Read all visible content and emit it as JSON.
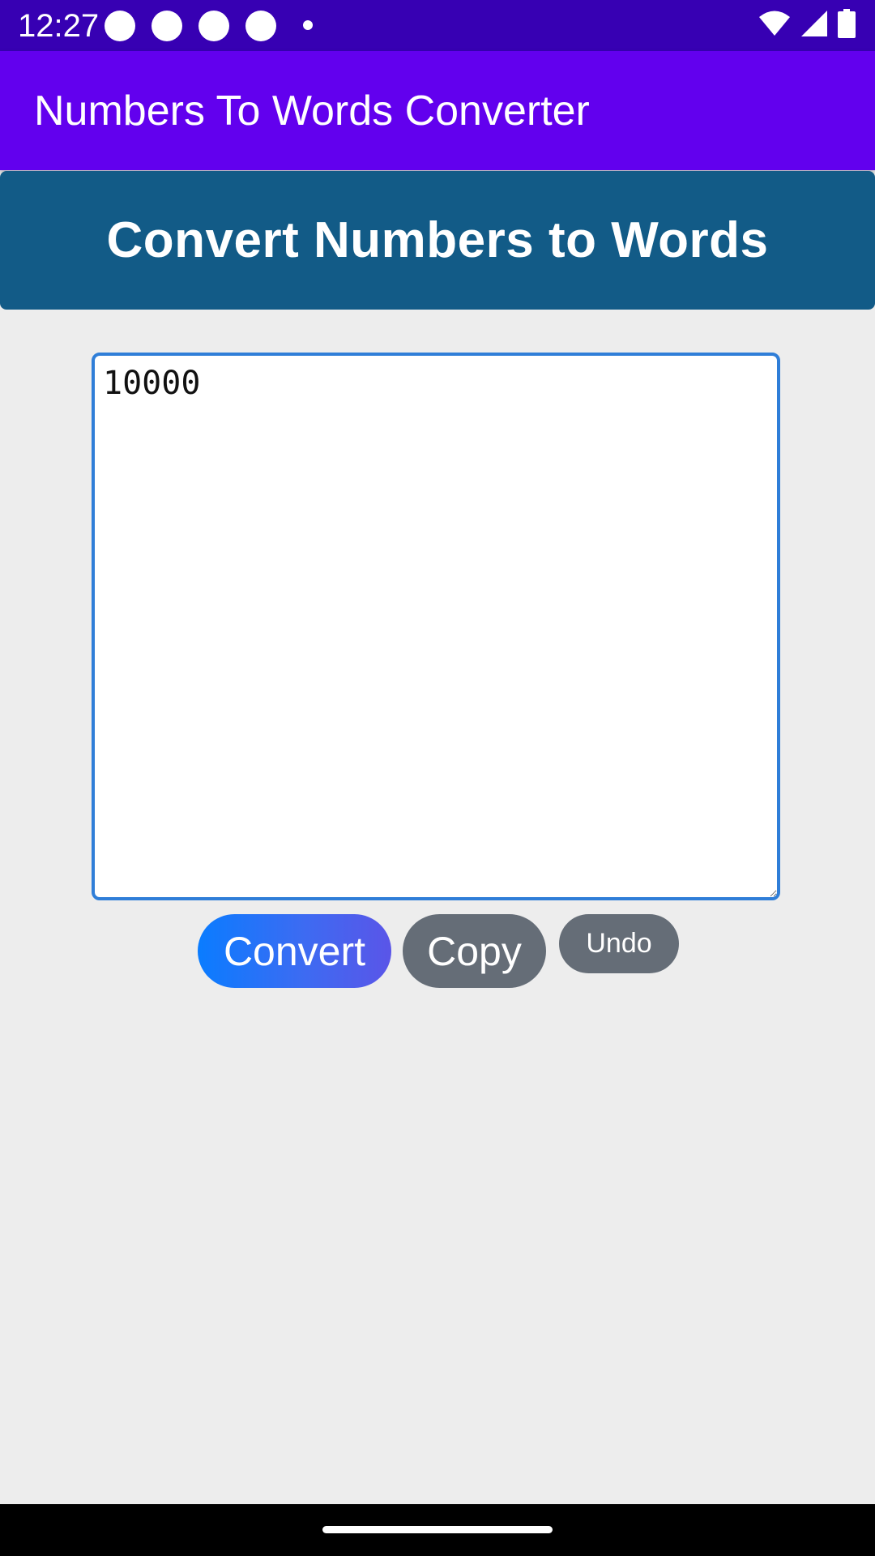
{
  "status_bar": {
    "time": "12:27",
    "notification_icons": [
      "notification-dot-icon",
      "notification-dot-icon",
      "notification-dot-icon",
      "notification-dot-icon"
    ],
    "icons": [
      "wifi-icon",
      "signal-icon",
      "battery-icon"
    ]
  },
  "app_bar": {
    "title": "Numbers To Words Converter"
  },
  "banner": {
    "title": "Convert Numbers to Words"
  },
  "input": {
    "value": "10000"
  },
  "buttons": {
    "convert_label": "Convert",
    "copy_label": "Copy",
    "undo_label": "Undo"
  },
  "colors": {
    "status_bar": "#3700b3",
    "app_bar": "#6200ee",
    "banner": "#125b87",
    "input_border": "#2f7ed8",
    "button_gray": "#656d77",
    "convert_gradient_start": "#0a7cff",
    "convert_gradient_end": "#5a55e8",
    "background": "#ededed"
  }
}
